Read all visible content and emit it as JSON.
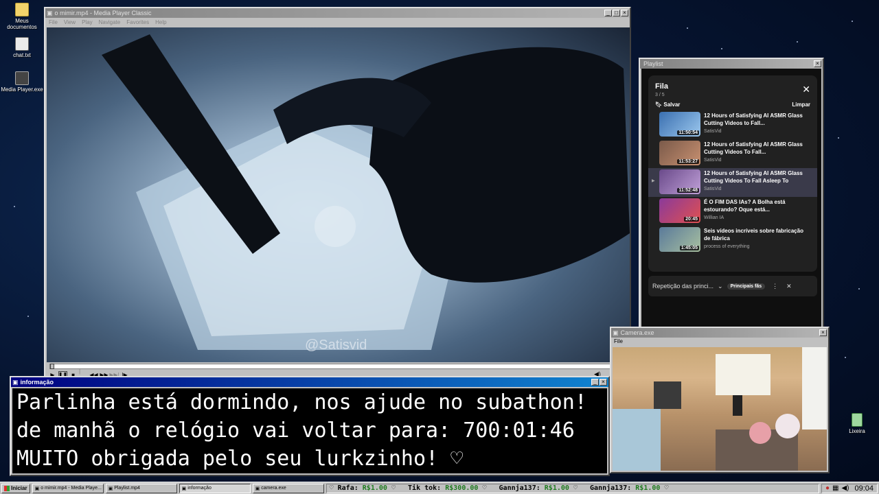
{
  "desktop": {
    "icons": [
      {
        "label": "Meus documentos",
        "icon": "folder-icon"
      },
      {
        "label": "chat.txt",
        "icon": "text-file-icon"
      },
      {
        "label": "Media Player.exe",
        "icon": "media-player-icon"
      },
      {
        "label": "Lixeira",
        "icon": "recycle-bin-icon"
      }
    ]
  },
  "mpc": {
    "title": "o mimir.mp4 - Media Player Classic",
    "menu": [
      "File",
      "View",
      "Play",
      "Navigate",
      "Favorites",
      "Help"
    ],
    "watermark": "@Satisvid"
  },
  "playlist": {
    "window_title": "Playlist",
    "panel_title": "Fila",
    "count": "3 / 5",
    "save_label": "Salvar",
    "clear_label": "Limpar",
    "items": [
      {
        "title": "12 Hours of Satisfying AI ASMR Glass Cutting Videos to Fall...",
        "channel": "SatisVid",
        "duration": "11:50:54",
        "thumb_color": "#3a6fb0"
      },
      {
        "title": "12 Hours of Satisfying AI ASMR Glass Cutting Videos To Fall...",
        "channel": "SatisVid",
        "duration": "11:53:27",
        "thumb_color": "#7a5a4a"
      },
      {
        "title": "12 Hours of Satisfying AI ASMR Glass Cutting Videos To Fall Asleep To",
        "channel": "SatisVid",
        "duration": "11:52:48",
        "thumb_color": "#6a4a8a"
      },
      {
        "title": "É O FIM DAS IAs? A Bolha está estourando? Oque está...",
        "channel": "Willian IA",
        "duration": "20:45",
        "thumb_color": "#8a3a9a"
      },
      {
        "title": "Seis vídeos incríveis sobre fabricação de fábrica",
        "channel": "process of everything",
        "duration": "1:45:05",
        "thumb_color": "#5a7a9a"
      }
    ],
    "mix_label": "Repetição das princi...",
    "mix_chip": "Principais fãs"
  },
  "info": {
    "title": "informação",
    "lines": [
      "Parlinha está dormindo, nos ajude no subathon!",
      "de manhã o relógio vai voltar para:  700:01:46",
      "MUITO obrigada pelo seu lurkzinho! ♡"
    ]
  },
  "camera": {
    "title": "Camera.exe",
    "menu": "File"
  },
  "taskbar": {
    "start_label": "Iniciar",
    "tasks": [
      "o mimir.mp4 - Media Playe...",
      "Playlist.mp4",
      "informação",
      "camera.exe"
    ],
    "ticker": [
      {
        "name": "Rafa:",
        "amount": "R$1.00"
      },
      {
        "name": "Tik tok:",
        "amount": "R$300.00"
      },
      {
        "name": "Gannja137:",
        "amount": "R$1.00"
      },
      {
        "name": "Gannja137:",
        "amount": "R$1.00"
      }
    ],
    "clock": "09:04"
  }
}
